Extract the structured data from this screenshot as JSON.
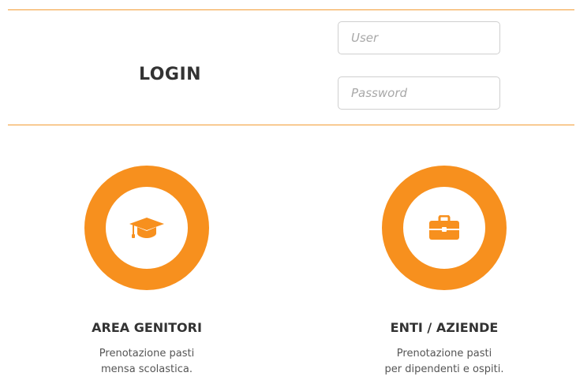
{
  "login": {
    "title": "LOGIN",
    "user_placeholder": "User",
    "password_placeholder": "Password"
  },
  "cards": [
    {
      "title": "AREA GENITORI",
      "desc_line1": "Prenotazione pasti",
      "desc_line2": "mensa scolastica.",
      "icon": "graduation-cap-icon"
    },
    {
      "title": "ENTI / AZIENDE",
      "desc_line1": "Prenotazione pasti",
      "desc_line2": "per dipendenti e ospiti.",
      "icon": "briefcase-icon"
    }
  ],
  "colors": {
    "accent": "#f7901e",
    "rule": "#f39c34",
    "text": "#333333"
  }
}
